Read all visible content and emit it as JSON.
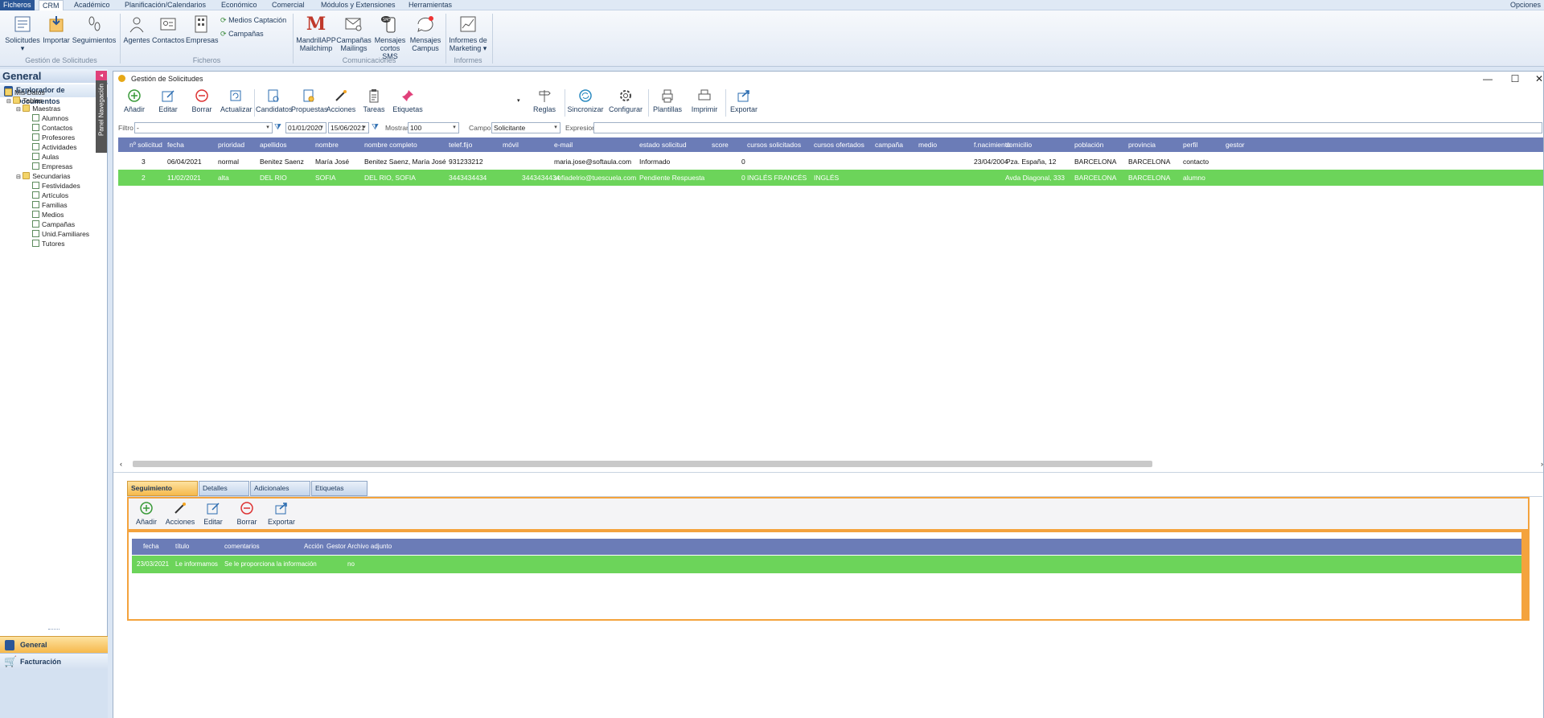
{
  "menubar": {
    "items": [
      "Ficheros",
      "CRM",
      "Académico",
      "Planificación/Calendarios",
      "Económico",
      "Comercial",
      "Módulos y Extensiones",
      "Herramientas"
    ],
    "right": "Opciones"
  },
  "ribbon": {
    "groups": [
      {
        "label": "Gestión de Solicitudes",
        "buttons": [
          "Solicitudes",
          "Importar",
          "Seguimientos"
        ]
      },
      {
        "label": "Ficheros",
        "buttons": [
          "Agentes",
          "Contactos",
          "Empresas"
        ],
        "small": [
          "Medios Captación",
          "Campañas"
        ]
      },
      {
        "label": "Comunicaciones",
        "buttons": [
          "MandrillAPP Mailchimp",
          "Campañas Mailings",
          "Mensajes cortos SMS",
          "Mensajes Campus"
        ]
      },
      {
        "label": "Informes",
        "buttons": [
          "Informes de Marketing"
        ]
      }
    ],
    "btn": {
      "solicitudes": "Solicitudes",
      "importar": "Importar",
      "seguimientos": "Seguimientos",
      "agentes": "Agentes",
      "contactos": "Contactos",
      "empresas": "Empresas",
      "medios": "Medios Captación",
      "campanas": "Campañas",
      "mandrill1": "MandrillAPP",
      "mandrill2": "Mailchimp",
      "mailings1": "Campañas",
      "mailings2": "Mailings",
      "sms1": "Mensajes",
      "sms2": "cortos SMS",
      "campus1": "Mensajes",
      "campus2": "Campus",
      "informes1": "Informes de",
      "informes2": "Marketing"
    },
    "group_labels": {
      "g1": "Gestión de Solicitudes",
      "g2": "Ficheros",
      "g3": "Comunicaciones",
      "g4": "Informes"
    }
  },
  "leftpanel": {
    "title": "General",
    "explorer": "Explorador de Documentos",
    "nav_tab": "Panel Navegación",
    "tree": {
      "root": "Mis Datos",
      "tablas": "Tablas",
      "maestras": "Maestras",
      "maestras_items": [
        "Alumnos",
        "Contactos",
        "Profesores",
        "Actividades",
        "Aulas",
        "Empresas"
      ],
      "secundarias": "Secundarias",
      "secundarias_items": [
        "Festividades",
        "Artículos",
        "Familias",
        "Medios",
        "Campañas",
        "Unid.Familiares",
        "Tutores"
      ]
    },
    "bottom": {
      "general": "General",
      "facturacion": "Facturación"
    }
  },
  "window": {
    "title": "Gestión de Solicitudes",
    "toolbar": {
      "anadir": "Añadir",
      "editar": "Editar",
      "borrar": "Borrar",
      "actualizar": "Actualizar",
      "candidatos": "Candidatos",
      "propuestas": "Propuestas",
      "acciones": "Acciones",
      "tareas": "Tareas",
      "etiquetas": "Etiquetas",
      "reglas": "Reglas",
      "sincronizar": "Sincronizar",
      "configurar": "Configurar",
      "plantillas": "Plantillas",
      "imprimir": "Imprimir",
      "exportar": "Exportar"
    },
    "filter": {
      "filtro_label": "Filtro :",
      "filtro_value": "-",
      "date_from": "01/01/2020",
      "date_to": "15/06/2021",
      "mostrar_label": "Mostrar :",
      "mostrar_value": "100",
      "campo_label": "Campo :",
      "campo_value": "Solicitante",
      "expresion_label": "Expresion :",
      "expresion_value": ""
    },
    "grid": {
      "columns": [
        "nº solicitud",
        "fecha",
        "prioridad",
        "apellidos",
        "nombre",
        "nombre completo",
        "telef.fijo",
        "móvil",
        "e-mail",
        "estado solicitud",
        "score",
        "cursos solicitados",
        "cursos ofertados",
        "campaña",
        "medio",
        "f.nacimiento",
        "domicilio",
        "población",
        "provincia",
        "perfil",
        "gestor"
      ],
      "rows": [
        {
          "num": "3",
          "fecha": "06/04/2021",
          "prioridad": "normal",
          "apellidos": "Benitez Saenz",
          "nombre": "María José",
          "nombre_completo": "Benitez Saenz, María José",
          "telefono": "931233212",
          "movil": "",
          "email": "maria.jose@softaula.com",
          "estado": "Informado",
          "score": "0",
          "cursos_sol": "",
          "cursos_ofe": "",
          "campana": "",
          "medio": "",
          "nacimiento": "23/04/2004",
          "domicilio": "Pza. España, 12",
          "poblacion": "BARCELONA",
          "provincia": "BARCELONA",
          "perfil": "contacto",
          "gestor": ""
        },
        {
          "num": "2",
          "fecha": "11/02/2021",
          "prioridad": "alta",
          "apellidos": "DEL RIO",
          "nombre": "SOFIA",
          "nombre_completo": "DEL RIO, SOFIA",
          "telefono": "3443434434",
          "movil": "3443434434",
          "email": "sofiadelrio@tuescuela.com",
          "estado": "Pendiente Respuesta",
          "score": "0",
          "cursos_sol": "INGLÉS FRANCÉS",
          "cursos_ofe": "INGLÉS",
          "campana": "",
          "medio": "",
          "nacimiento": "",
          "domicilio": "Avda Diagonal, 333",
          "poblacion": "BARCELONA",
          "provincia": "BARCELONA",
          "perfil": "alumno",
          "gestor": ""
        }
      ]
    },
    "bottom": {
      "tabs": [
        "Seguimiento",
        "Detalles",
        "Adicionales",
        "Etiquetas"
      ],
      "toolbar": {
        "anadir": "Añadir",
        "acciones": "Acciones",
        "editar": "Editar",
        "borrar": "Borrar",
        "exportar": "Exportar"
      },
      "columns": [
        "fecha",
        "título",
        "comentarios",
        "Acción",
        "Gestor",
        "Archivo adjunto"
      ],
      "rows": [
        {
          "fecha": "23/03/2021",
          "titulo": "Le informamos",
          "comentarios": "Se le proporciona la información",
          "accion": "",
          "gestor": "",
          "adjunto": "no"
        }
      ]
    }
  },
  "colors": {
    "header_blue": "#6b7cb7",
    "row_green": "#6cd45a",
    "accent_orange": "#f4a33d",
    "menu_blue": "#2b5797"
  }
}
